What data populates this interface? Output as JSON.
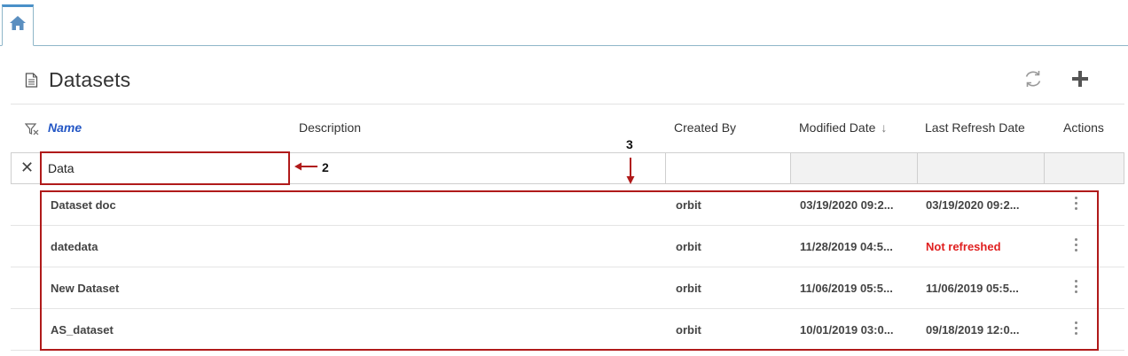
{
  "tabs": {
    "home_icon": "home-icon"
  },
  "header": {
    "title": "Datasets"
  },
  "columns": {
    "name": "Name",
    "description": "Description",
    "created_by": "Created By",
    "modified_date": "Modified Date",
    "sort_arrow": "↓",
    "last_refresh": "Last Refresh Date",
    "actions": "Actions"
  },
  "filter": {
    "name_value": "Data",
    "clear_glyph": "✕"
  },
  "rows": [
    {
      "name": "Dataset doc",
      "created_by": "orbit",
      "modified": "03/19/2020 09:2...",
      "refreshed": "03/19/2020 09:2..."
    },
    {
      "name": "datedata",
      "created_by": "orbit",
      "modified": "11/28/2019 04:5...",
      "refreshed": "Not refreshed"
    },
    {
      "name": "New Dataset",
      "created_by": "orbit",
      "modified": "11/06/2019 05:5...",
      "refreshed": "11/06/2019 05:5..."
    },
    {
      "name": "AS_dataset",
      "created_by": "orbit",
      "modified": "10/01/2019 03:0...",
      "refreshed": "09/18/2019 12:0..."
    }
  ],
  "annotations": {
    "filter_label": "2",
    "rows_label": "3"
  },
  "colors": {
    "accent": "#2457c5",
    "warning": "#e02020",
    "annotation": "#b01a1a"
  }
}
